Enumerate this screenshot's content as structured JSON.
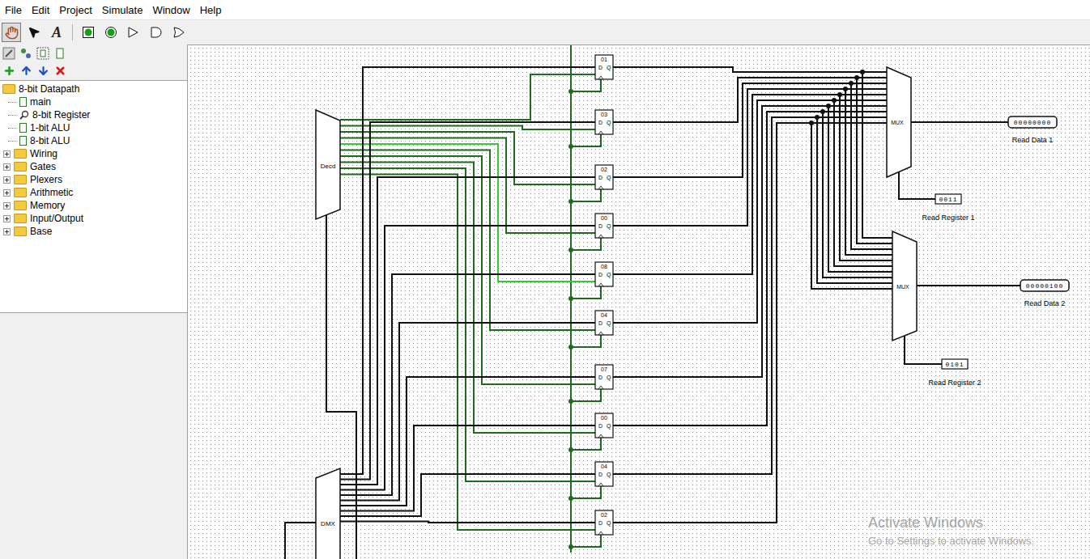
{
  "menu": [
    "File",
    "Edit",
    "Project",
    "Simulate",
    "Window",
    "Help"
  ],
  "toolbar": {
    "tools": [
      {
        "kind": "hand",
        "selected": true
      },
      {
        "kind": "arrow",
        "selected": false
      },
      {
        "kind": "text",
        "label": "A",
        "selected": false
      },
      {
        "kind": "input-pin",
        "selected": false
      },
      {
        "kind": "output-pin",
        "selected": false
      },
      {
        "kind": "not-gate",
        "selected": false
      },
      {
        "kind": "and-gate",
        "selected": false
      },
      {
        "kind": "or-gate",
        "selected": false
      }
    ]
  },
  "explorer": {
    "root": {
      "name": "8-bit Datapath",
      "expanded": true
    },
    "circuits": [
      {
        "name": "main",
        "current": false
      },
      {
        "name": "8-bit Register",
        "current": true
      },
      {
        "name": "1-bit ALU",
        "current": false
      },
      {
        "name": "8-bit ALU",
        "current": false
      }
    ],
    "libraries": [
      {
        "name": "Wiring",
        "expanded": false
      },
      {
        "name": "Gates",
        "expanded": false
      },
      {
        "name": "Plexers",
        "expanded": false
      },
      {
        "name": "Arithmetic",
        "expanded": false
      },
      {
        "name": "Memory",
        "expanded": false
      },
      {
        "name": "Input/Output",
        "expanded": false
      },
      {
        "name": "Base",
        "expanded": false
      }
    ]
  },
  "canvas": {
    "decoder": "Decd",
    "demux": "DMX",
    "register_pins": {
      "d": "D",
      "q": "Q"
    },
    "registers": [
      {
        "label": "01",
        "color": "#1f6b1f"
      },
      {
        "label": "03",
        "color": "#1f6b1f"
      },
      {
        "label": "02",
        "color": "#1f6b1f"
      },
      {
        "label": "00",
        "color": "#1f6b1f"
      },
      {
        "label": "08",
        "color": "#33cc33"
      },
      {
        "label": "04",
        "color": "#1f6b1f"
      },
      {
        "label": "07",
        "color": "#1f6b1f"
      },
      {
        "label": "00",
        "color": "#1f6b1f"
      },
      {
        "label": "04",
        "color": "#1f6b1f"
      },
      {
        "label": "02",
        "color": "#1f6b1f"
      }
    ],
    "muxes": [
      {
        "label": "MUX",
        "output": {
          "label": "Read Data 1",
          "value": "00000000"
        },
        "select": {
          "label": "Read Register 1",
          "value": "0011"
        }
      },
      {
        "label": "MUX",
        "output": {
          "label": "Read Data 2",
          "value": "00000100"
        },
        "select": {
          "label": "Read Register 2",
          "value": "0101"
        }
      }
    ]
  },
  "watermark": {
    "title": "Activate Windows",
    "subtitle": "Go to Settings to activate Windows."
  }
}
